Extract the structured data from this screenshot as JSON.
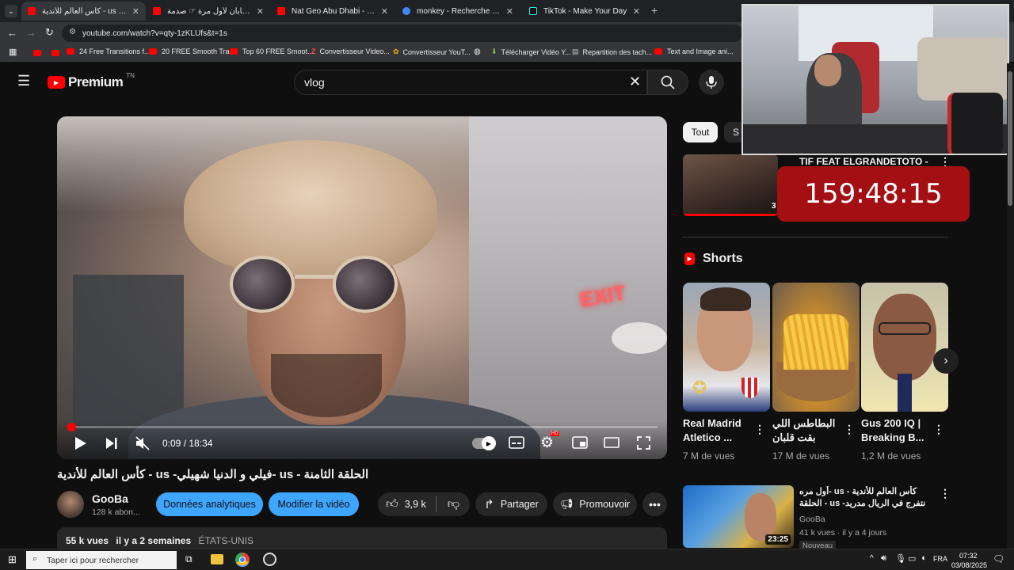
{
  "browser": {
    "tabs": [
      {
        "title": "كأس العالم للأندية - us -فيلي و ال...",
        "color": "#ff0000",
        "active": true
      },
      {
        "title": "عربي في اليابان لأول مرة ☞ صدمة...",
        "color": "#ff0000",
        "active": false
      },
      {
        "title": "Nat Geo Abu Dhabi - YouTube",
        "color": "#ff0000",
        "active": false
      },
      {
        "title": "monkey - Recherche Google",
        "color": "#4285f4",
        "active": false
      },
      {
        "title": "TikTok - Make Your Day",
        "color": "#111111",
        "active": false
      }
    ],
    "new_tab": "+",
    "url": "youtube.com/watch?v=qty-1zKLUfs&t=1s",
    "bookmarks": [
      "24 Free Transitions f...",
      "20 FREE Smooth Tra...",
      "Top 60 FREE Smoot...",
      "Convertisseur Video...",
      "Convertisseur YouT...",
      "Télécharger Vidéo Y...",
      "Repartition des tach...",
      "Text and Image ani..."
    ]
  },
  "yt": {
    "logo": "Premium",
    "country": "TN",
    "search_value": "vlog",
    "accent": "#ff0000"
  },
  "player": {
    "time": "0:09 / 18:34",
    "progress": 0.008,
    "exit_text": "EXIT",
    "hd_badge": "HD"
  },
  "video": {
    "title": "الحلقة الثامنة - us -فيلي و الدنيا شهيلي- us - كأس العالم للأندية",
    "channel": "GooBa",
    "subs": "128 k abon...",
    "analytics_btn": "Données analytiques",
    "edit_btn": "Modifier la vidéo",
    "likes": "3,9 k",
    "share": "Partager",
    "promote": "Promouvoir",
    "views": "55 k vues",
    "date": "il y a 2 semaines",
    "location": "ÉTATS-UNIS"
  },
  "sidebar": {
    "chips": [
      "Tout",
      "S"
    ],
    "rec1_title": "TIF FEAT ELGRANDETOTO -",
    "rec1_duration": "3",
    "shorts_label": "Shorts",
    "shorts": [
      {
        "title": "Real Madrid Atletico ...",
        "views": "7 M de vues"
      },
      {
        "title": "البطاطس اللي بقت قلبان وردود...",
        "views": "17 M de vues"
      },
      {
        "title": "Gus 200 IQ | Breaking B...",
        "views": "1,2 M de vues"
      }
    ],
    "rec2": {
      "title": "كأس العالم للأندية - us -أول مره نتفرج في الريال مدريد- us - الحلقة التاسعة",
      "channel": "GooBa",
      "meta": "41 k vues · il y a 4 jours",
      "badge": "Nouveau",
      "duration": "23:25"
    }
  },
  "overlay": {
    "timer": "159:48:15"
  },
  "taskbar": {
    "search_placeholder": "Taper ici pour rechercher",
    "lang": "FRA",
    "time": "07:32",
    "date": "03/08/2025"
  }
}
